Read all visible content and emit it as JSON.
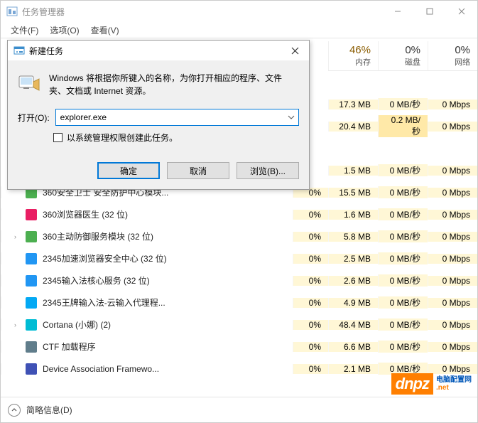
{
  "window": {
    "title": "任务管理器"
  },
  "menu": {
    "file": "文件(F)",
    "options": "选项(O)",
    "view": "查看(V)"
  },
  "columns": {
    "mem": {
      "pct": "46%",
      "label": "内存"
    },
    "disk": {
      "pct": "0%",
      "label": "磁盘"
    },
    "net": {
      "pct": "0%",
      "label": "网络"
    }
  },
  "rows": [
    {
      "expandable": false,
      "name": "",
      "cpu": "",
      "mem": "",
      "disk": "",
      "net": "",
      "blank": true
    },
    {
      "expandable": false,
      "name": "",
      "cpu": "",
      "mem": "17.3 MB",
      "disk": "0 MB/秒",
      "net": "0 Mbps"
    },
    {
      "expandable": false,
      "name": "",
      "cpu": "",
      "mem": "20.4 MB",
      "disk": "0.2 MB/秒",
      "net": "0 Mbps",
      "disk_heat": true
    },
    {
      "expandable": false,
      "name": "",
      "cpu": "",
      "mem": "",
      "disk": "",
      "net": "",
      "blank": true
    },
    {
      "expandable": false,
      "name": "",
      "cpu": "",
      "mem": "1.5 MB",
      "disk": "0 MB/秒",
      "net": "0 Mbps"
    },
    {
      "expandable": false,
      "name": "360安全卫士 安全防护中心模块...",
      "cpu": "0%",
      "mem": "15.5 MB",
      "disk": "0 MB/秒",
      "net": "0 Mbps",
      "icon": "#4caf50"
    },
    {
      "expandable": false,
      "name": "360浏览器医生 (32 位)",
      "cpu": "0%",
      "mem": "1.6 MB",
      "disk": "0 MB/秒",
      "net": "0 Mbps",
      "icon": "#e91e63"
    },
    {
      "expandable": true,
      "name": "360主动防御服务模块 (32 位)",
      "cpu": "0%",
      "mem": "5.8 MB",
      "disk": "0 MB/秒",
      "net": "0 Mbps",
      "icon": "#4caf50"
    },
    {
      "expandable": false,
      "name": "2345加速浏览器安全中心 (32 位)",
      "cpu": "0%",
      "mem": "2.5 MB",
      "disk": "0 MB/秒",
      "net": "0 Mbps",
      "icon": "#2196f3"
    },
    {
      "expandable": false,
      "name": "2345输入法核心服务 (32 位)",
      "cpu": "0%",
      "mem": "2.6 MB",
      "disk": "0 MB/秒",
      "net": "0 Mbps",
      "icon": "#2196f3"
    },
    {
      "expandable": false,
      "name": "2345王牌输入法-云输入代理程...",
      "cpu": "0%",
      "mem": "4.9 MB",
      "disk": "0 MB/秒",
      "net": "0 Mbps",
      "icon": "#03a9f4"
    },
    {
      "expandable": true,
      "name": "Cortana (小娜) (2)",
      "cpu": "0%",
      "mem": "48.4 MB",
      "disk": "0 MB/秒",
      "net": "0 Mbps",
      "icon": "#00bcd4"
    },
    {
      "expandable": false,
      "name": "CTF 加载程序",
      "cpu": "0%",
      "mem": "6.6 MB",
      "disk": "0 MB/秒",
      "net": "0 Mbps",
      "icon": "#607d8b"
    },
    {
      "expandable": false,
      "name": "Device Association Framewo...",
      "cpu": "0%",
      "mem": "2.1 MB",
      "disk": "0 MB/秒",
      "net": "0 Mbps",
      "icon": "#3f51b5"
    }
  ],
  "footer": {
    "details": "简略信息(D)"
  },
  "dialog": {
    "title": "新建任务",
    "description": "Windows 将根据你所键入的名称，为你打开相应的程序、文件夹、文档或 Internet 资源。",
    "open_label": "打开(O):",
    "input_value": "explorer.exe",
    "admin_check": "以系统管理权限创建此任务。",
    "ok": "确定",
    "cancel": "取消",
    "browse": "浏览(B)..."
  },
  "watermark": {
    "brand": "dnpz",
    "line1": "电脑配置网",
    "line2": ".net"
  }
}
